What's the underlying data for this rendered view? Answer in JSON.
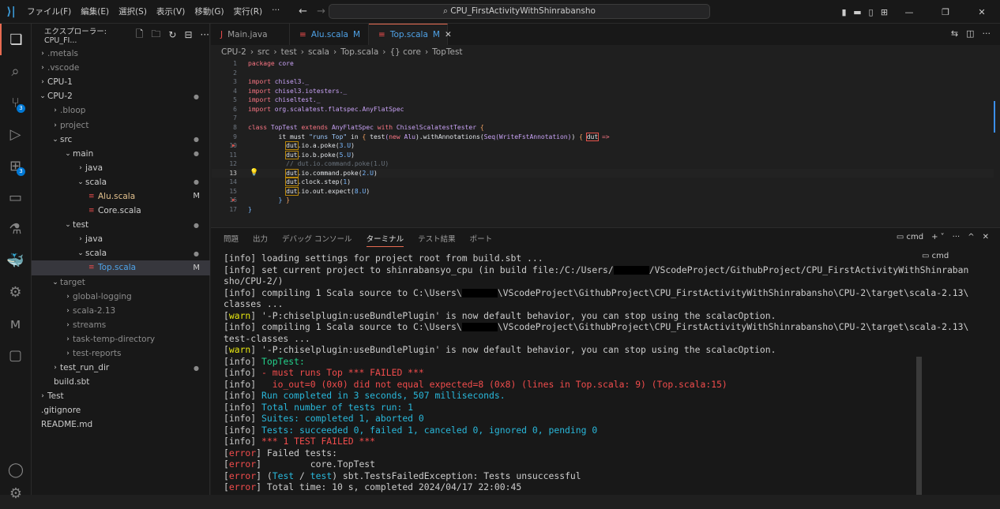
{
  "titlebar": {
    "menu": [
      "ファイル(F)",
      "編集(E)",
      "選択(S)",
      "表示(V)",
      "移動(G)",
      "実行(R)",
      "···"
    ],
    "search": "CPU_FirstActivityWithShinrabansho"
  },
  "activity": {
    "badges": {
      "scm": "3",
      "extensions": "3"
    }
  },
  "explorer": {
    "title": "エクスプローラー: CPU_FI...",
    "items": [
      {
        "label": ".metals",
        "depth": 1,
        "chev": ">",
        "dim": true
      },
      {
        "label": ".vscode",
        "depth": 1,
        "chev": ">",
        "dim": true
      },
      {
        "label": "CPU-1",
        "depth": 1,
        "chev": ">"
      },
      {
        "label": "CPU-2",
        "depth": 1,
        "chev": "v",
        "dot": true
      },
      {
        "label": ".bloop",
        "depth": 2,
        "chev": ">",
        "dim": true
      },
      {
        "label": "project",
        "depth": 2,
        "chev": ">",
        "dim": true
      },
      {
        "label": "src",
        "depth": 2,
        "chev": "v",
        "dot": true
      },
      {
        "label": "main",
        "depth": 3,
        "chev": "v",
        "dot": true
      },
      {
        "label": "java",
        "depth": 4,
        "chev": ">"
      },
      {
        "label": "scala",
        "depth": 4,
        "chev": "v",
        "dot": true
      },
      {
        "label": "Alu.scala",
        "depth": 5,
        "file": true,
        "mod": "M"
      },
      {
        "label": "Core.scala",
        "depth": 5,
        "file": true
      },
      {
        "label": "test",
        "depth": 3,
        "chev": "v",
        "dot": true
      },
      {
        "label": "java",
        "depth": 4,
        "chev": ">"
      },
      {
        "label": "scala",
        "depth": 4,
        "chev": "v",
        "dot": true
      },
      {
        "label": "Top.scala",
        "depth": 5,
        "file": true,
        "mod": "M",
        "selected": true
      },
      {
        "label": "target",
        "depth": 2,
        "chev": "v",
        "dim": true
      },
      {
        "label": "global-logging",
        "depth": 3,
        "chev": ">",
        "dim": true
      },
      {
        "label": "scala-2.13",
        "depth": 3,
        "chev": ">",
        "dim": true
      },
      {
        "label": "streams",
        "depth": 3,
        "chev": ">",
        "dim": true
      },
      {
        "label": "task-temp-directory",
        "depth": 3,
        "chev": ">",
        "dim": true
      },
      {
        "label": "test-reports",
        "depth": 3,
        "chev": ">",
        "dim": true
      },
      {
        "label": "test_run_dir",
        "depth": 2,
        "chev": ">",
        "dot": true
      },
      {
        "label": "build.sbt",
        "depth": 2,
        "file": true
      },
      {
        "label": "Test",
        "depth": 1,
        "chev": ">"
      },
      {
        "label": ".gitignore",
        "depth": 1,
        "file": true
      },
      {
        "label": "README.md",
        "depth": 1,
        "file": true
      }
    ]
  },
  "tabs": [
    {
      "label": "Main.java",
      "icon": "J",
      "mod": ""
    },
    {
      "label": "Alu.scala",
      "icon": "≡",
      "mod": "M"
    },
    {
      "label": "Top.scala",
      "icon": "≡",
      "mod": "M",
      "active": true
    }
  ],
  "breadcrumb": [
    "CPU-2",
    "src",
    "test",
    "scala",
    "Top.scala",
    "{} core",
    "TopTest"
  ],
  "code": [
    [
      [
        "kw",
        "package "
      ],
      [
        "id",
        "core"
      ]
    ],
    [],
    [
      [
        "kw",
        "import "
      ],
      [
        "id",
        "chisel3._"
      ]
    ],
    [
      [
        "kw",
        "import "
      ],
      [
        "id",
        "chisel3.iotesters._"
      ]
    ],
    [
      [
        "kw",
        "import "
      ],
      [
        "id",
        "chiseltest._"
      ]
    ],
    [
      [
        "kw",
        "import "
      ],
      [
        "id",
        "org.scalatest.flatspec.AnyFlatSpec"
      ]
    ],
    [],
    [
      [
        "kw",
        "class "
      ],
      [
        "id",
        "TopTest "
      ],
      [
        "kw",
        "extends "
      ],
      [
        "id",
        "AnyFlatSpec "
      ],
      [
        "kw",
        "with "
      ],
      [
        "id",
        "ChiselScalatestTester "
      ],
      [
        "br",
        "{"
      ]
    ],
    [
      [
        "pl",
        "        it must "
      ],
      [
        "st",
        "\"runs Top\""
      ],
      [
        "pl",
        " in "
      ],
      [
        "br",
        "{ "
      ],
      [
        "pl",
        "test"
      ],
      [
        "id",
        "("
      ],
      [
        "kw",
        "new "
      ],
      [
        "id",
        "Alu"
      ],
      [
        "pl",
        ").withAnnotations("
      ],
      [
        "id",
        "Seq(WriteFstAnnotation)"
      ],
      [
        "pl",
        ") "
      ],
      [
        "br",
        "{ "
      ],
      [
        "dutr",
        "dut"
      ],
      [
        "kw",
        " =>"
      ]
    ],
    [
      [
        "pl",
        "          "
      ],
      [
        "dut",
        "dut"
      ],
      [
        "pl",
        ".io.a.poke("
      ],
      [
        "nm",
        "3.U"
      ],
      [
        "pl",
        ")"
      ]
    ],
    [
      [
        "pl",
        "          "
      ],
      [
        "dut",
        "dut"
      ],
      [
        "pl",
        ".io.b.poke("
      ],
      [
        "nm",
        "5.U"
      ],
      [
        "pl",
        ")"
      ]
    ],
    [
      [
        "cm",
        "          // dut.io.command.poke(1.U)"
      ]
    ],
    [
      [
        "pl",
        "          "
      ],
      [
        "dut",
        "dut"
      ],
      [
        "pl",
        ".io.command.poke("
      ],
      [
        "nm",
        "2.U"
      ],
      [
        "pl",
        ")"
      ]
    ],
    [
      [
        "pl",
        "          "
      ],
      [
        "dut",
        "dut"
      ],
      [
        "pl",
        ".clock.step("
      ],
      [
        "nm",
        "1"
      ],
      [
        "pl",
        ")"
      ]
    ],
    [
      [
        "pl",
        "          "
      ],
      [
        "dut",
        "dut"
      ],
      [
        "pl",
        ".io.out.expect("
      ],
      [
        "nm",
        "8.U"
      ],
      [
        "pl",
        ")"
      ]
    ],
    [
      [
        "nm",
        "        } "
      ],
      [
        "br",
        "}"
      ]
    ],
    [
      [
        "nm",
        "}"
      ]
    ]
  ],
  "panel": {
    "tabs": [
      "問題",
      "出力",
      "デバッグ コンソール",
      "ターミナル",
      "テスト結果",
      "ポート"
    ],
    "active": 3,
    "shell": "cmd"
  },
  "terminal": [
    [
      [
        "w",
        "[info] loading settings for project root from build.sbt ..."
      ]
    ],
    [
      [
        "w",
        "[info] set current project to shinrabansyo_cpu (in build file:/C:/Users/"
      ],
      [
        "x",
        ""
      ],
      [
        "w",
        "/VScodeProject/GithubProject/CPU_FirstActivityWithShinraban"
      ]
    ],
    [
      [
        "w",
        "sho/CPU-2/)"
      ]
    ],
    [
      [
        "w",
        "[info] compiling 1 Scala source to C:\\Users\\"
      ],
      [
        "x",
        ""
      ],
      [
        "w",
        "\\VScodeProject\\GithubProject\\CPU_FirstActivityWithShinrabansho\\CPU-2\\target\\scala-2.13\\"
      ]
    ],
    [
      [
        "w",
        "classes ..."
      ]
    ],
    [
      [
        "w",
        "["
      ],
      [
        "y",
        "warn"
      ],
      [
        "w",
        "] '-P:chiselplugin:useBundlePlugin' is now default behavior, you can stop using the scalacOption."
      ]
    ],
    [
      [
        "w",
        "[info] compiling 1 Scala source to C:\\Users\\"
      ],
      [
        "x",
        ""
      ],
      [
        "w",
        "\\VScodeProject\\GithubProject\\CPU_FirstActivityWithShinrabansho\\CPU-2\\target\\scala-2.13\\"
      ]
    ],
    [
      [
        "w",
        "test-classes ..."
      ]
    ],
    [
      [
        "w",
        "["
      ],
      [
        "y",
        "warn"
      ],
      [
        "w",
        "] '-P:chiselplugin:useBundlePlugin' is now default behavior, you can stop using the scalacOption."
      ]
    ],
    [
      [
        "w",
        "[info] "
      ],
      [
        "gr",
        "TopTest:"
      ]
    ],
    [
      [
        "w",
        "[info] "
      ],
      [
        "r",
        "- must runs Top *** FAILED ***"
      ]
    ],
    [
      [
        "w",
        "[info] "
      ],
      [
        "r",
        "  io_out=0 (0x0) did not equal expected=8 (0x8) (lines in Top.scala: 9) (Top.scala:15)"
      ]
    ],
    [
      [
        "w",
        "[info] "
      ],
      [
        "g",
        "Run completed in 3 seconds, 507 milliseconds."
      ]
    ],
    [
      [
        "w",
        "[info] "
      ],
      [
        "g",
        "Total number of tests run: 1"
      ]
    ],
    [
      [
        "w",
        "[info] "
      ],
      [
        "g",
        "Suites: completed 1, aborted 0"
      ]
    ],
    [
      [
        "w",
        "[info] "
      ],
      [
        "g",
        "Tests: succeeded 0, failed 1, canceled 0, ignored 0, pending 0"
      ]
    ],
    [
      [
        "w",
        "[info] "
      ],
      [
        "r",
        "*** 1 TEST FAILED ***"
      ]
    ],
    [
      [
        "w",
        "["
      ],
      [
        "r",
        "error"
      ],
      [
        "w",
        "] Failed tests:"
      ]
    ],
    [
      [
        "w",
        "["
      ],
      [
        "r",
        "error"
      ],
      [
        "w",
        "]         core.TopTest"
      ]
    ],
    [
      [
        "w",
        "["
      ],
      [
        "r",
        "error"
      ],
      [
        "w",
        "] ("
      ],
      [
        "g",
        "Test"
      ],
      [
        "w",
        " / "
      ],
      [
        "g",
        "test"
      ],
      [
        "w",
        ") sbt.TestsFailedException: Tests unsuccessful"
      ]
    ],
    [
      [
        "w",
        "["
      ],
      [
        "r",
        "error"
      ],
      [
        "w",
        "] Total time: 10 s, completed 2024/04/17 22:00:45"
      ]
    ]
  ]
}
